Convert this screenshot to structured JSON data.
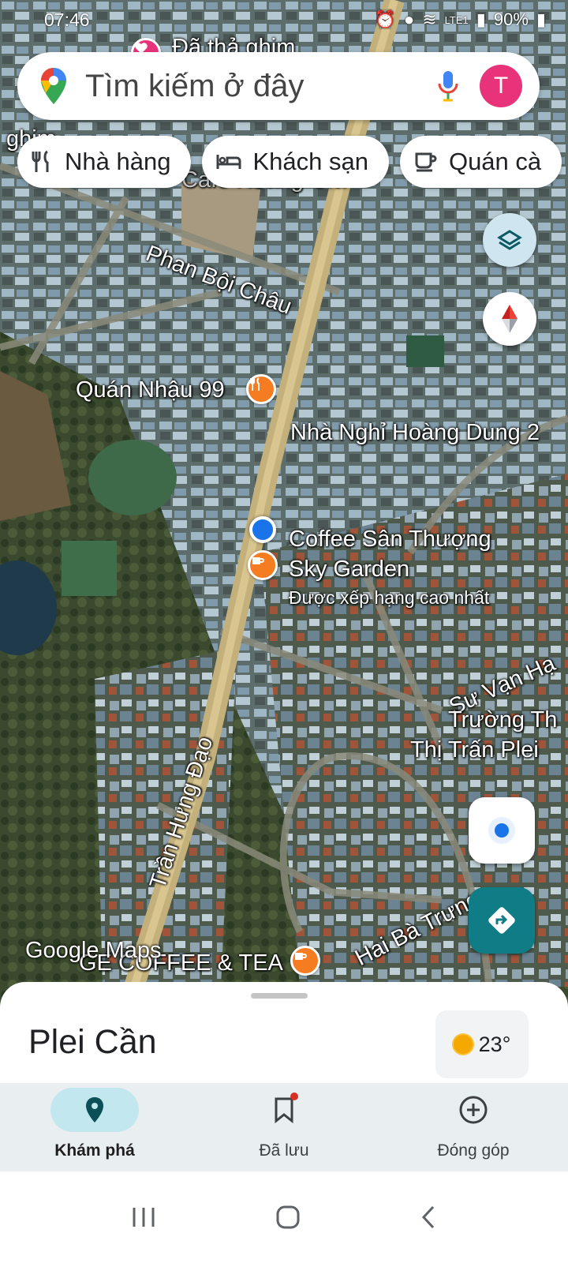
{
  "status_bar": {
    "time": "07:46",
    "battery": "90%",
    "network": "LTE1"
  },
  "search": {
    "placeholder": "Tìm kiếm ở đây",
    "avatar_letter": "T"
  },
  "chips": [
    {
      "label": "Nhà hàng",
      "icon": "fork-knife-icon"
    },
    {
      "label": "Khách sạn",
      "icon": "bed-icon"
    },
    {
      "label": "Quán cà",
      "icon": "coffee-icon"
    }
  ],
  "map": {
    "labels": {
      "pinned": "Đã thả ghim",
      "pinned_left": "ghim",
      "street_phan_boi_chau": "Phan Bội Châu",
      "quan_nhau": "Quán Nhậu 99",
      "nha_nghi": "Nhà Nghỉ Hoàng Dung 2",
      "coffee_line1": "Coffee Sân Thượng",
      "coffee_line2": "Sky Garden",
      "coffee_sub": "Được xếp hạng cao nhất",
      "su_van_hanh": "Sư Vạn Hạ",
      "truong_line1": "Trường Th",
      "truong_line2": "Thị Trấn Plei",
      "tran_hung_dao": "Trần Hưng Đạo",
      "hai_ba_trung": "Hai Bà Trưng",
      "ge_coffee": "GE COFFEE & TEA",
      "cafe_top": "Café Hoàng Gia"
    },
    "attribution": "Google Maps"
  },
  "bottom_sheet": {
    "place_name": "Plei Cần",
    "temperature": "23°"
  },
  "nav": {
    "items": [
      {
        "label": "Khám phá",
        "icon": "explore-pin-icon",
        "active": true
      },
      {
        "label": "Đã lưu",
        "icon": "bookmark-icon",
        "active": false
      },
      {
        "label": "Đóng góp",
        "icon": "add-circle-icon",
        "active": false
      }
    ]
  },
  "colors": {
    "accent_teal": "#0f7c86",
    "avatar": "#e8327a",
    "pin_orange": "#f57c21",
    "location_blue": "#1a73e8"
  }
}
